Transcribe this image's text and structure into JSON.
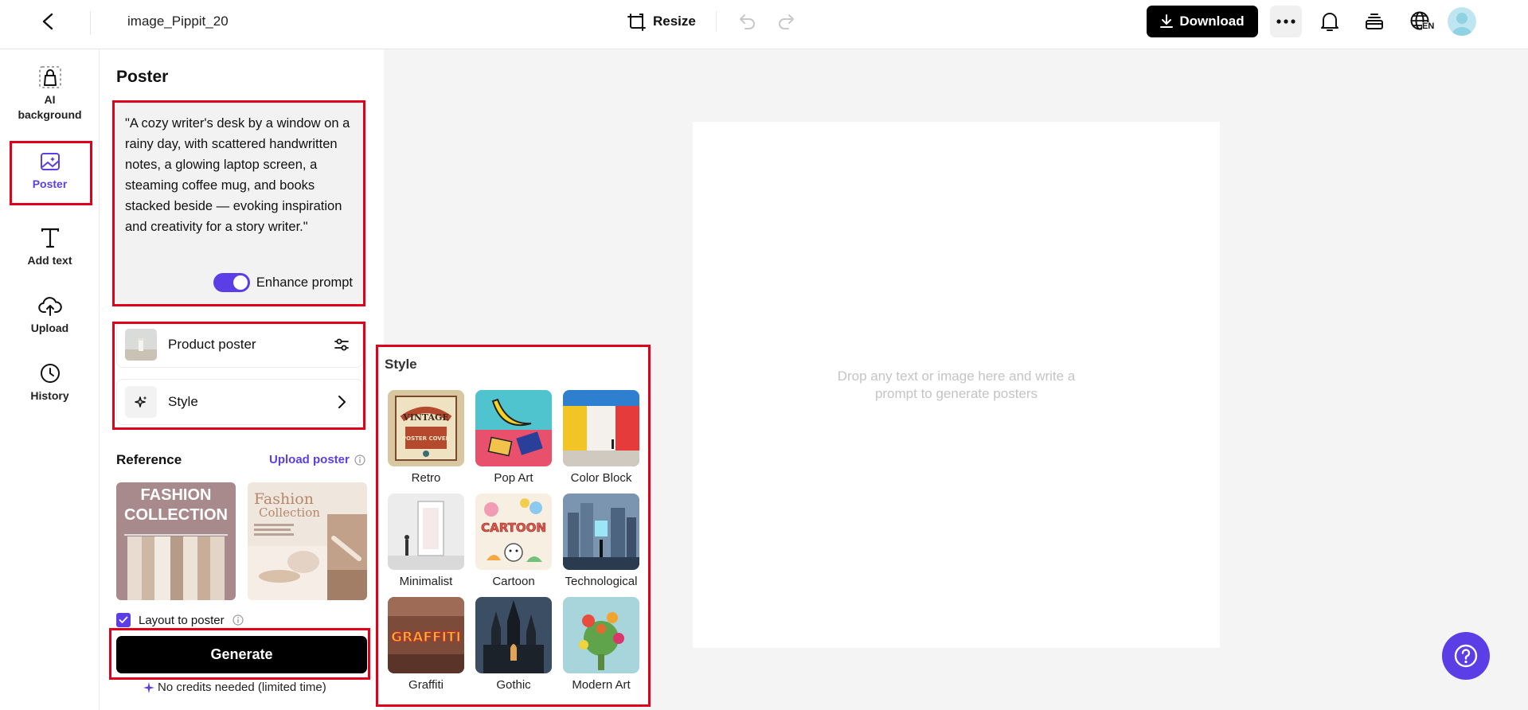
{
  "topbar": {
    "file_name": "image_Pippit_20",
    "resize_label": "Resize",
    "download_label": "Download",
    "language_badge": "EN"
  },
  "leftnav": {
    "items": [
      {
        "label": "AI background",
        "icon": "ai-background-icon"
      },
      {
        "label": "Poster",
        "icon": "poster-icon",
        "active": true
      },
      {
        "label": "Add text",
        "icon": "text-icon"
      },
      {
        "label": "Upload",
        "icon": "upload-icon"
      },
      {
        "label": "History",
        "icon": "clock-icon"
      }
    ]
  },
  "panel": {
    "title": "Poster",
    "prompt": "\"A cozy writer's desk by a window on a rainy day, with scattered handwritten notes, a glowing laptop screen, a steaming coffee mug, and books stacked beside — evoking inspiration and creativity for a story writer.\"",
    "enhance_label": "Enhance prompt",
    "enhance_on": true,
    "product_poster_label": "Product poster",
    "style_label": "Style",
    "reference_title": "Reference",
    "upload_poster_label": "Upload poster",
    "references": [
      {
        "line1": "FASHION",
        "line2": "COLLECTION"
      },
      {
        "line1": "Fashion",
        "line2": "Collection"
      }
    ],
    "layout_label": "Layout to poster",
    "layout_checked": true,
    "generate_label": "Generate",
    "credits_note": "No credits needed (limited time)"
  },
  "style_popover": {
    "title": "Style",
    "styles": [
      {
        "label": "Retro"
      },
      {
        "label": "Pop Art"
      },
      {
        "label": "Color Block"
      },
      {
        "label": "Minimalist"
      },
      {
        "label": "Cartoon"
      },
      {
        "label": "Technological"
      },
      {
        "label": "Graffiti"
      },
      {
        "label": "Gothic"
      },
      {
        "label": "Modern Art"
      }
    ],
    "thumb_text": {
      "retro": "VINTAGE",
      "retro_sub": "POSTER COVER",
      "cartoon": "CARTOON",
      "graffiti": "GRAFFITI"
    }
  },
  "canvas": {
    "hint_line1": "Drop any text or image here and write a",
    "hint_line2": "prompt to generate posters"
  },
  "colors": {
    "accent": "#5b3ee6",
    "highlight": "#e0001b"
  }
}
